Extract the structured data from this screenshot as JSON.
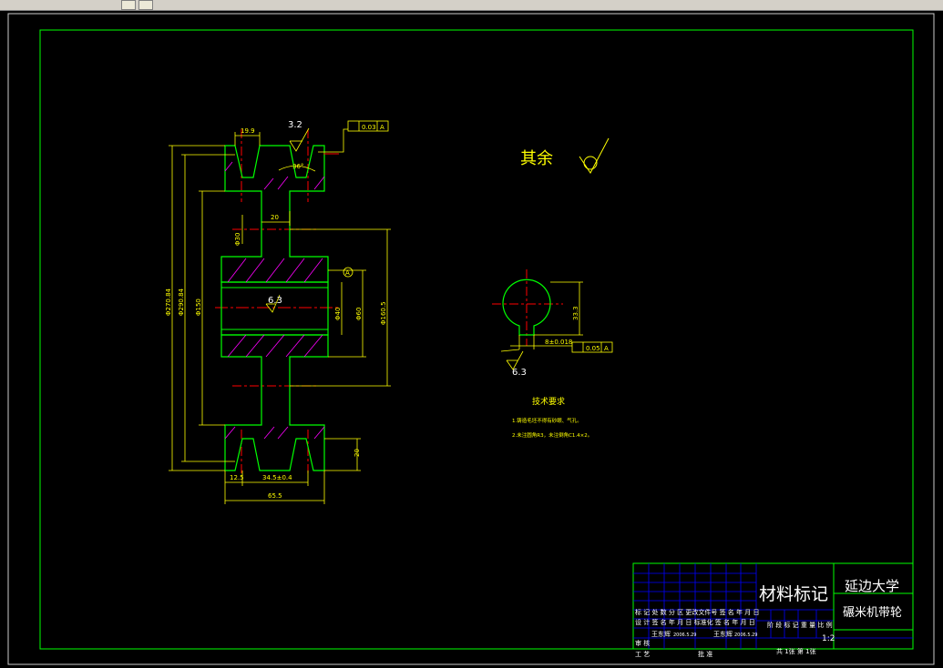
{
  "window": {
    "toolbar_icons": [
      "draw-tool-icon",
      "properties-icon"
    ]
  },
  "colors": {
    "background": "#000000",
    "outline": "#00ff00",
    "dimension": "#ffff00",
    "centerline": "#ff0000",
    "hatch": "#ff00ff",
    "text": "#ffffff",
    "grid": "#0000ff"
  },
  "drawing": {
    "roughness_top": "3.2",
    "roughness_bore": "6.3",
    "roughness_keyway": "6.3",
    "angle": "36°",
    "tolerance_runout": "0.03",
    "datum_top": "A",
    "datum_bore": "A",
    "datum_keyway": "A",
    "tolerance_sym": "0.05",
    "keyway_width_tol": "8±0.018",
    "keyway_depth": "33.3",
    "others_label": "其余",
    "dims": {
      "groove_pitch": "19.9",
      "rim_width": "20",
      "groove_depth": "20",
      "d_small": "Φ30",
      "d_bore": "Φ30",
      "d_hub": "Φ60",
      "d_150": "Φ150",
      "d_160": "Φ160.5",
      "d_outer1": "Φ270.84",
      "d_outer2": "Φ290.84",
      "pitch_bottom": "34.5±0.4",
      "left_bottom": "12.5",
      "total_width": "65.5",
      "hub_vertical": "Φ40"
    },
    "tech_req_title": "技术要求",
    "tech_req_items": [
      "1.铸造毛坯不得有砂眼、气孔。",
      "2.未注圆角R3，未注倒角C1.4×2。"
    ]
  },
  "title_block": {
    "material": "材料标记",
    "school": "延边大学",
    "part_name": "碾米机带轮",
    "row1": "标 记 处 数  分 区  更改文件号 签 名 年 月 日",
    "row2": "设 计 签 名 年 月 日 标准化 签 名 年 月 日",
    "designer": "王东辉",
    "design_date": "2006.5.29",
    "approver": "王东辉",
    "approve_date": "2006.5.29",
    "labels_mid": "阶 段 标 记  重 量  比 例",
    "scale": "1:2",
    "review": "审 核",
    "process": "工 艺",
    "approve": "批 准",
    "sheets": "共 1张   第 1张"
  }
}
